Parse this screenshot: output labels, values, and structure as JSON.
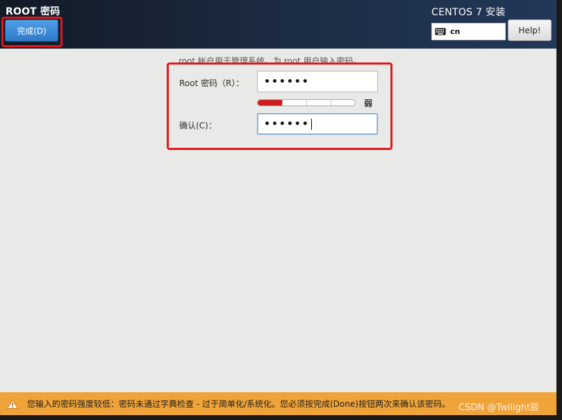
{
  "header": {
    "title": "ROOT 密码",
    "done_label": "完成(D)",
    "product": "CENTOS 7 安装",
    "keyboard_layout": "cn",
    "help_label": "Help!"
  },
  "content": {
    "description": "root 帐户用于管理系统。为 root 用户输入密码。",
    "root_label": "Root 密码（R）：",
    "root_value": "••••••",
    "strength_fraction": 0.25,
    "strength_label": "弱",
    "confirm_label": "确认(C)：",
    "confirm_value": "••••••"
  },
  "warning": {
    "text": "您输入的密码强度较低：密码未通过字典检查 - 过于简单化/系统化。您必须按完成(Done)按钮两次来确认该密码。",
    "color": "#efa339"
  },
  "watermark": "CSDN @Twilight辰",
  "colors": {
    "accent": "#2f79c8",
    "highlight": "#e3171b",
    "strength_fill": "#ce1b1b"
  }
}
